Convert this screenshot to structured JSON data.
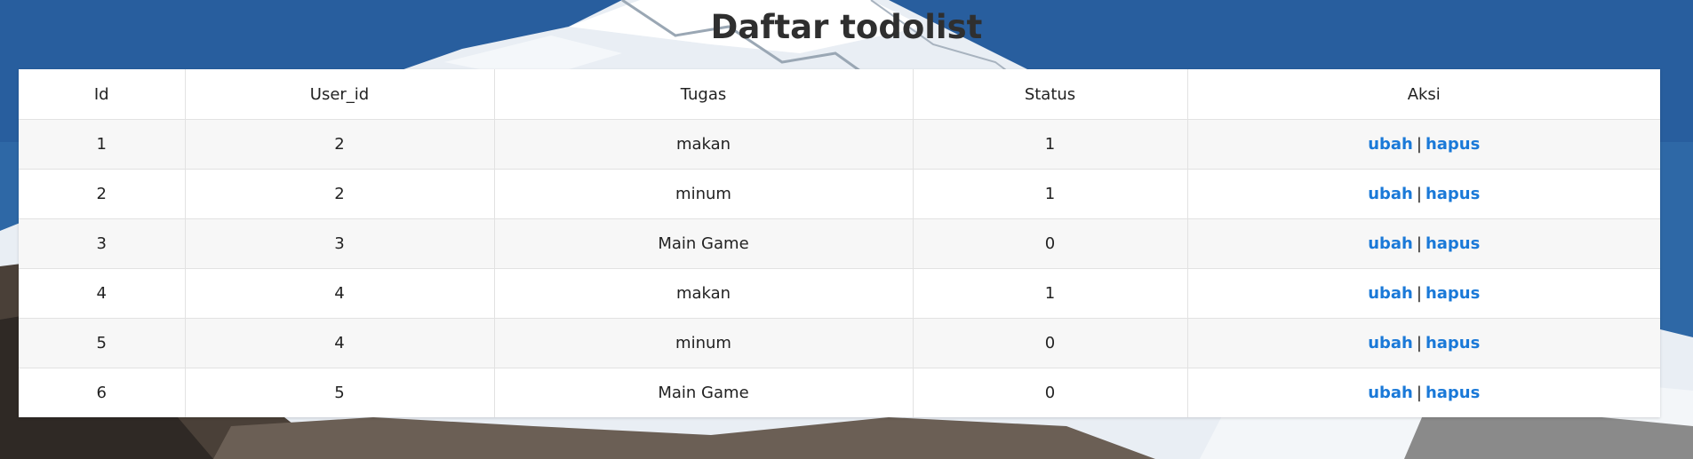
{
  "page": {
    "title": "Daftar todolist"
  },
  "table": {
    "headers": [
      "Id",
      "User_id",
      "Tugas",
      "Status",
      "Aksi"
    ],
    "rows": [
      {
        "id": "1",
        "user_id": "2",
        "tugas": "makan",
        "status": "1",
        "edit": "ubah",
        "sep": "|",
        "delete": "hapus"
      },
      {
        "id": "2",
        "user_id": "2",
        "tugas": "minum",
        "status": "1",
        "edit": "ubah",
        "sep": "|",
        "delete": "hapus"
      },
      {
        "id": "3",
        "user_id": "3",
        "tugas": "Main Game",
        "status": "0",
        "edit": "ubah",
        "sep": "|",
        "delete": "hapus"
      },
      {
        "id": "4",
        "user_id": "4",
        "tugas": "makan",
        "status": "1",
        "edit": "ubah",
        "sep": "|",
        "delete": "hapus"
      },
      {
        "id": "5",
        "user_id": "4",
        "tugas": "minum",
        "status": "0",
        "edit": "ubah",
        "sep": "|",
        "delete": "hapus"
      },
      {
        "id": "6",
        "user_id": "5",
        "tugas": "Main Game",
        "status": "0",
        "edit": "ubah",
        "sep": "|",
        "delete": "hapus"
      }
    ]
  },
  "colors": {
    "link": "#1a79d8",
    "title": "#2f2f2f",
    "row_stripe": "#f7f7f7",
    "sky": "#2a64a2",
    "snow": "#ffffff"
  }
}
